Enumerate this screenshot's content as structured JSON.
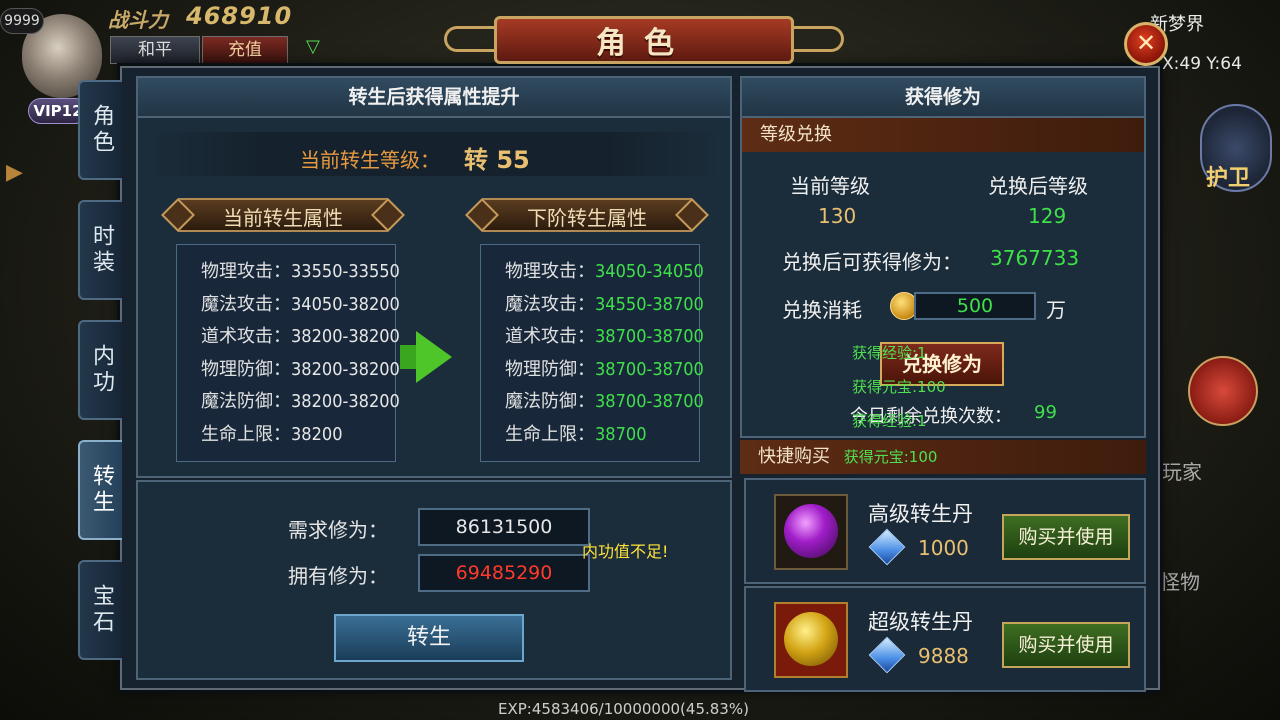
{
  "hud": {
    "level_badge": "9999",
    "power_label": "战斗力",
    "power_value": "468910",
    "peace_btn": "和平",
    "recharge_btn": "充值",
    "vip": "VIP12",
    "map_name": "新梦界",
    "coords": "X:49 Y:64",
    "guard_label": "护卫",
    "player_label": "玩家",
    "monster_label": "怪物",
    "exp": "EXP:4583406/10000000(45.83%)"
  },
  "window": {
    "title": "角色",
    "close_glyph": "✕"
  },
  "side_tabs": [
    {
      "label": "角色",
      "active": false
    },
    {
      "label": "时装",
      "active": false
    },
    {
      "label": "内功",
      "active": false
    },
    {
      "label": "转生",
      "active": true
    },
    {
      "label": "宝石",
      "active": false
    }
  ],
  "rebirth": {
    "header": "转生后获得属性提升",
    "current_level_label": "当前转生等级：",
    "current_level_value": "转 55",
    "current_ribbon": "当前转生属性",
    "next_ribbon": "下阶转生属性",
    "current_attrs": [
      {
        "key": "物理攻击：",
        "value": "33550-33550"
      },
      {
        "key": "魔法攻击：",
        "value": "34050-38200"
      },
      {
        "key": "道术攻击：",
        "value": "38200-38200"
      },
      {
        "key": "物理防御：",
        "value": "38200-38200"
      },
      {
        "key": "魔法防御：",
        "value": "38200-38200"
      },
      {
        "key": "生命上限：",
        "value": "38200"
      }
    ],
    "next_attrs": [
      {
        "key": "物理攻击：",
        "value": "34050-34050"
      },
      {
        "key": "魔法攻击：",
        "value": "34550-38700"
      },
      {
        "key": "道术攻击：",
        "value": "38700-38700"
      },
      {
        "key": "物理防御：",
        "value": "38700-38700"
      },
      {
        "key": "魔法防御：",
        "value": "38700-38700"
      },
      {
        "key": "生命上限：",
        "value": "38700"
      }
    ],
    "required_label": "需求修为：",
    "required_value": "86131500",
    "owned_label": "拥有修为：",
    "owned_value": "69485290",
    "warning": "内功值不足!",
    "rebirth_button": "转生"
  },
  "cultivation": {
    "header": "获得修为",
    "exchange_subhead": "等级兑换",
    "cur_level_label": "当前等级",
    "cur_level_value": "130",
    "after_level_label": "兑换后等级",
    "after_level_value": "129",
    "gain_label": "兑换后可获得修为：",
    "gain_value": "3767733",
    "cost_label": "兑换消耗",
    "cost_value": "500",
    "cost_unit": "万",
    "exchange_button": "兑换修为",
    "remaining_label": "今日剩余兑换次数：",
    "remaining_value": "99",
    "float_msgs": [
      "获得经验:1",
      "获得元宝:100",
      "获得经验:1",
      "获得元宝:100"
    ],
    "quick_buy_subhead": "快捷购买",
    "items": [
      {
        "name": "高级转生丹",
        "price": "1000",
        "button": "购买并使用"
      },
      {
        "name": "超级转生丹",
        "price": "9888",
        "button": "购买并使用"
      }
    ]
  },
  "colors": {
    "accent_gold": "#e8c070",
    "green_value": "#3fe04a",
    "red_value": "#ff3a2a",
    "warning_yellow": "#ffe23a",
    "panel_bg": "#16222e"
  }
}
